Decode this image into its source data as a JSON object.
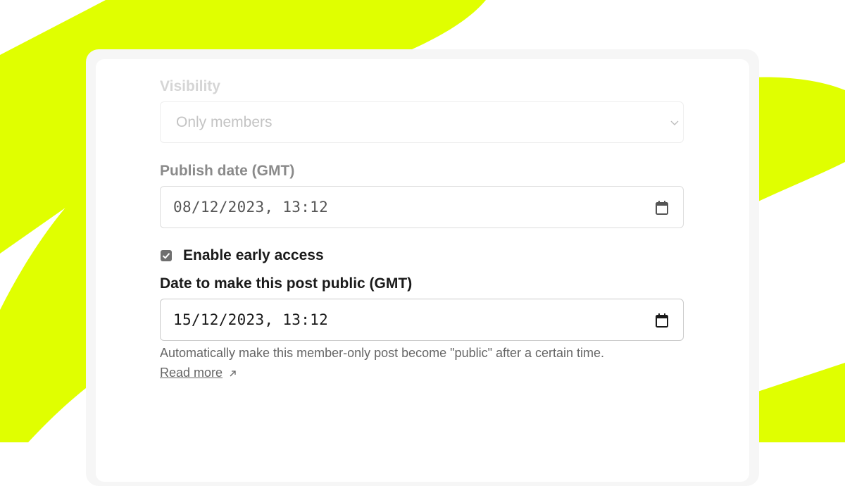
{
  "colors": {
    "accent": "#e0ff00",
    "text": "#1a1a1a",
    "muted": "#8a8a8a",
    "border": "#dcdcdc"
  },
  "visibility": {
    "label": "Visibility",
    "selected": "Only members",
    "icon": "chevron-down-icon"
  },
  "publish_date": {
    "label": "Publish date (GMT)",
    "value": "08/12/2023, 13:12",
    "icon": "calendar-icon"
  },
  "early_access": {
    "label": "Enable early access",
    "checked": true
  },
  "public_date": {
    "label": "Date to make this post public (GMT)",
    "value": "15/12/2023, 13:12",
    "icon": "calendar-icon"
  },
  "help": {
    "text": "Automatically make this member-only post become \"public\" after a certain time.",
    "link": "Read more",
    "link_icon": "external-arrow-icon"
  }
}
